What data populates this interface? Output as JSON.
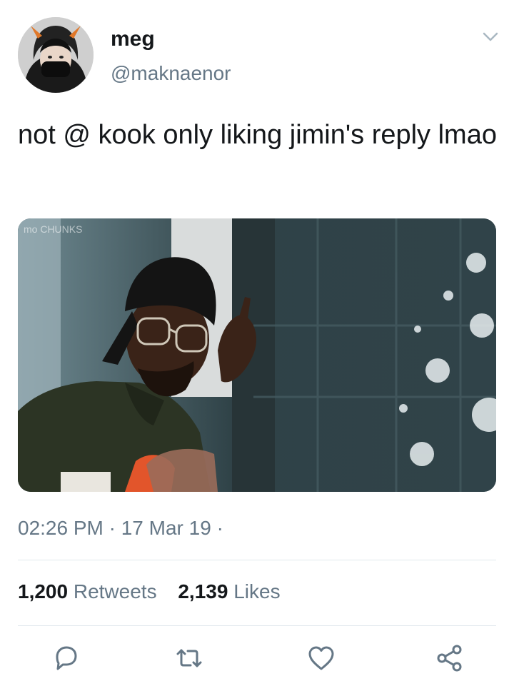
{
  "author": {
    "name": "meg",
    "handle": "@maknaenor"
  },
  "tweet": {
    "text": "not @ kook only liking jimin's reply lmao",
    "media_watermark": "mo CHUNKS",
    "timestamp": "02:26 PM · 17 Mar 19 ·"
  },
  "stats": {
    "retweets_count": "1,200",
    "retweets_label": "Retweets",
    "likes_count": "2,139",
    "likes_label": "Likes"
  },
  "icons": {
    "menu": "chevron-down-icon",
    "reply": "reply-icon",
    "retweet": "retweet-icon",
    "like": "heart-icon",
    "share": "share-icon"
  },
  "colors": {
    "text": "#14171a",
    "secondary": "#657786",
    "divider": "#e1e8ed"
  }
}
